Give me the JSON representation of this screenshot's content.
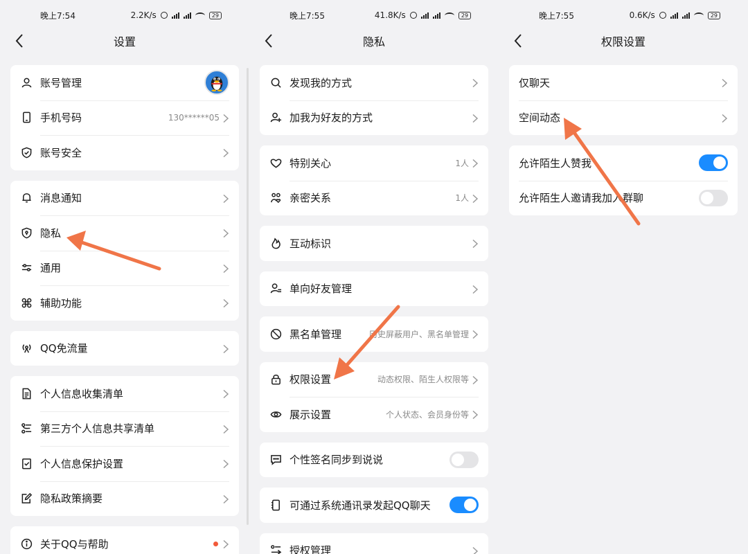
{
  "panels": [
    {
      "status": {
        "time": "晚上7:54",
        "speed": "2.2K/s",
        "battery": "29"
      },
      "title": "设置",
      "groups": [
        [
          {
            "icon": "user-icon",
            "label": "账号管理",
            "avatar": true
          },
          {
            "icon": "phone-icon",
            "label": "手机号码",
            "value": "130******05"
          },
          {
            "icon": "shield-check-icon",
            "label": "账号安全"
          }
        ],
        [
          {
            "icon": "bell-icon",
            "label": "消息通知"
          },
          {
            "icon": "privacy-shield-icon",
            "label": "隐私"
          },
          {
            "icon": "sliders-icon",
            "label": "通用"
          },
          {
            "icon": "command-icon",
            "label": "辅助功能"
          }
        ],
        [
          {
            "icon": "antenna-icon",
            "label": "QQ免流量"
          }
        ],
        [
          {
            "icon": "document-list-icon",
            "label": "个人信息收集清单"
          },
          {
            "icon": "share-list-icon",
            "label": "第三方个人信息共享清单"
          },
          {
            "icon": "check-doc-icon",
            "label": "个人信息保护设置"
          },
          {
            "icon": "edit-doc-icon",
            "label": "隐私政策摘要"
          }
        ],
        [
          {
            "icon": "info-icon",
            "label": "关于QQ与帮助",
            "dot": true
          }
        ]
      ]
    },
    {
      "status": {
        "time": "晚上7:55",
        "speed": "41.8K/s",
        "battery": "29"
      },
      "title": "隐私",
      "groups": [
        [
          {
            "icon": "search-icon",
            "label": "发现我的方式"
          },
          {
            "icon": "add-user-icon",
            "label": "加我为好友的方式"
          }
        ],
        [
          {
            "icon": "heart-icon",
            "label": "特别关心",
            "value": "1人"
          },
          {
            "icon": "intimate-icon",
            "label": "亲密关系",
            "value": "1人"
          }
        ],
        [
          {
            "icon": "flame-icon",
            "label": "互动标识"
          }
        ],
        [
          {
            "icon": "user-manage-icon",
            "label": "单向好友管理"
          }
        ],
        [
          {
            "icon": "block-icon",
            "label": "黑名单管理",
            "value": "历史屏蔽用户、黑名单管理"
          }
        ],
        [
          {
            "icon": "lock-icon",
            "label": "权限设置",
            "value": "动态权限、陌生人权限等"
          },
          {
            "icon": "eye-icon",
            "label": "展示设置",
            "value": "个人状态、会员身份等"
          }
        ],
        [
          {
            "icon": "chat-icon",
            "label": "个性签名同步到说说",
            "toggle": "off"
          }
        ],
        [
          {
            "icon": "contacts-icon",
            "label": "可通过系统通讯录发起QQ聊天",
            "toggle": "on"
          }
        ],
        [
          {
            "icon": "authorize-icon",
            "label": "授权管理"
          }
        ]
      ]
    },
    {
      "status": {
        "time": "晚上7:55",
        "speed": "0.6K/s",
        "battery": "29"
      },
      "title": "权限设置",
      "groups": [
        [
          {
            "label": "仅聊天"
          },
          {
            "label": "空间动态"
          }
        ],
        [
          {
            "label": "允许陌生人赞我",
            "toggle": "on"
          },
          {
            "label": "允许陌生人邀请我加入群聊",
            "toggle": "off"
          }
        ]
      ]
    }
  ],
  "colors": {
    "accent": "#1a8cff",
    "annotation_arrow": "#f07548",
    "dot": "#f25a3a"
  }
}
